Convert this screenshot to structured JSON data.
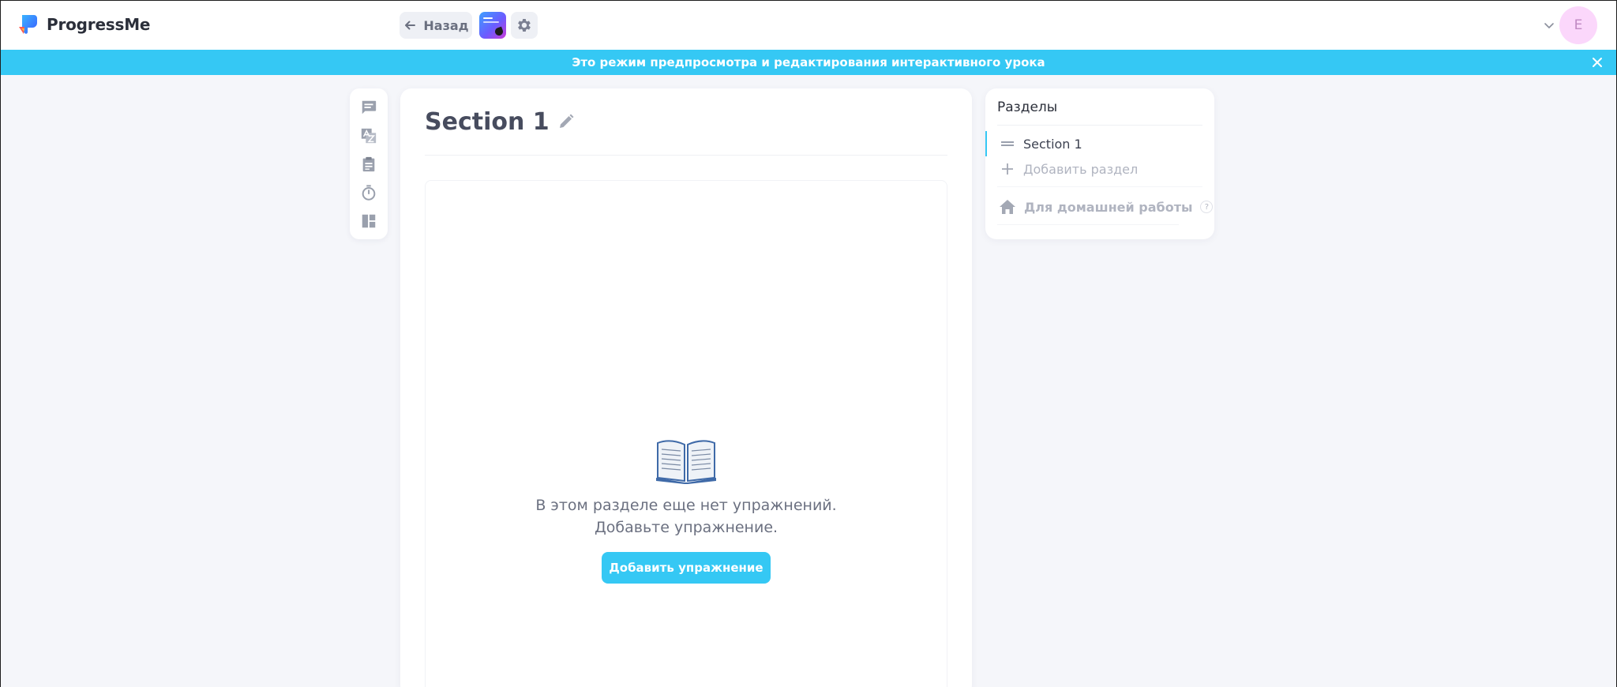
{
  "app": {
    "brand": "ProgressMe"
  },
  "header": {
    "back_label": "Назад",
    "avatar_initial": "E"
  },
  "banner": {
    "text": "Это режим предпросмотра и редактирования интерактивного урока"
  },
  "tools": [
    {
      "icon": "message-icon"
    },
    {
      "icon": "translate-icon"
    },
    {
      "icon": "clipboard-icon"
    },
    {
      "icon": "timer-icon"
    },
    {
      "icon": "layout-icon"
    }
  ],
  "main": {
    "section_title": "Section 1",
    "empty_line1": "В этом разделе еще нет упражнений.",
    "empty_line2": "Добавьте упражнение.",
    "add_exercise_label": "Добавить упражнение"
  },
  "sections_panel": {
    "title": "Разделы",
    "items": [
      {
        "label": "Section 1",
        "active": true
      }
    ],
    "add_label": "Добавить раздел",
    "homework_label": "Для домашней работы",
    "help_mark": "?"
  },
  "colors": {
    "accent": "#35c8f4",
    "background": "#f5f6fa",
    "avatar_bg": "#fbd7fb"
  }
}
